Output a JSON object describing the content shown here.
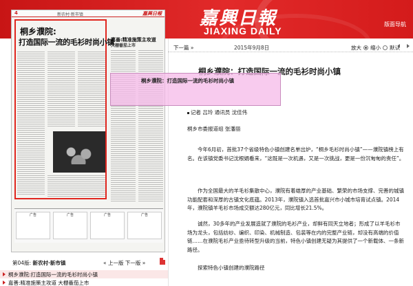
{
  "header": {
    "logo_cn": "嘉興日報",
    "logo_en": "JIAXING DAILY",
    "nav_label": "版面导航"
  },
  "paper": {
    "page_no": "4",
    "section_mini": "新农村·新市镇",
    "masthead_mini": "嘉興日報",
    "headline_1": "桐乡濮院:",
    "headline_2": "打造国际一流的毛衫时尚小镇",
    "side_headline": "嘉善:精准施策主攻道",
    "side_subhead": "大棚番茄上市",
    "ad_cells": [
      "广告",
      "广告",
      "广告",
      "广告"
    ]
  },
  "page_info": {
    "label": "第04版:",
    "name": "新农村·新市镇",
    "prev": "上一版",
    "next": "下一版"
  },
  "article_list": [
    {
      "title": "桐乡濮院:打造国际一流的毛衫时尚小镇",
      "active": true
    },
    {
      "title": "嘉善:精准施策主攻道 大棚番茄上市",
      "active": false
    }
  ],
  "toolbar": {
    "prev_article": "下一篇",
    "date": "2015年9月8日",
    "zoom_in": "放大",
    "zoom_mid": "缩小",
    "zoom_out": "默认"
  },
  "article": {
    "title": "桐乡濮院：打造国际一流的毛衫时尚小镇",
    "author": "记者 吕玲 通讯员 沈佳伟",
    "photo_credit": "桐乡市委报道组 张潘丽",
    "paragraphs": [
      "今年6月初，首批37个省级特色小镇创建名单出炉，“桐乡毛衫时尚小镇”——濮院镇榜上有名。在该镇党委书记沈根娟看来，“这既是一次机遇，又是一次挑战，更是一份沉甸甸的责任”。",
      "作为全国最大的羊毛衫集散中心，濮院有着雄厚的产业基础、繁荣的市场支撑、完善的城镇功能配套和深厚的古镇文化底蕴。2013年，濮院镇入选首批嘉兴市小城市培育试点镇。2014年，濮院镇羊毛衫市场成交额达280亿元，同比增长21.5%。",
      "诚然，30多年的产业发展造就了濮院的毛衫产业，却鲜有同天立地者；形成了以羊毛衫市场为龙头，包括纺纱、编织、印染、机械制造、包装等在内的完整产业链，却没有高端的价值链……在濮院毛衫产业亟待转型升级的当前，特色小镇创建无疑为其提供了一个新载体、一条新路径。",
      "探索特色小镇创建的濮院路径"
    ]
  },
  "popup": {
    "text": "桐乡濮院：打造国际一流的毛衫时尚小镇"
  }
}
